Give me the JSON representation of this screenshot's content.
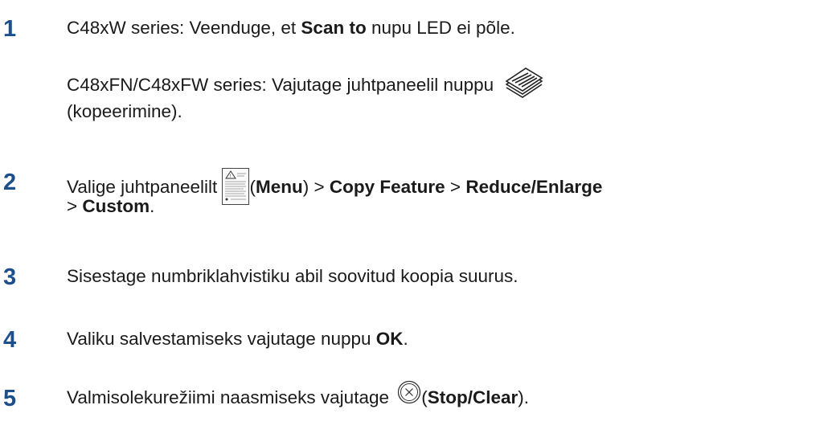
{
  "steps": [
    {
      "number": "1",
      "lines": [
        {
          "pre": "C48xW series: Veenduge, et ",
          "bold": "Scan to",
          "post": " nupu LED ei põle."
        },
        {
          "pre": "C48xFN/C48xFW series: Vajutage juhtpaneelil nuppu"
        },
        {
          "pre": "(kopeerimine)."
        }
      ],
      "icon": "copy-icon"
    },
    {
      "number": "2",
      "line1": {
        "pre": "Valige juhtpaneelilt ",
        "paren_open": "(",
        "menu": "Menu",
        "paren_close": ")",
        "sep1": " > ",
        "copy_feature": "Copy Feature",
        "sep2": " > ",
        "reduce": "Reduce/Enlarge"
      },
      "line2": {
        "sep": "> ",
        "custom": "Custom",
        "end": "."
      },
      "icon": "menu-icon"
    },
    {
      "number": "3",
      "text": "Sisestage numbriklahvistiku abil soovitud koopia suurus."
    },
    {
      "number": "4",
      "pre": "Valiku salvestamiseks vajutage nuppu ",
      "bold": "OK",
      "post": "."
    },
    {
      "number": "5",
      "pre": "Valmisolekurežiimi naasmiseks vajutage ",
      "paren_open": "(",
      "bold": "Stop/Clear",
      "post": ").",
      "icon": "stop-clear-icon"
    }
  ],
  "colors": {
    "step_number": "#1d4f8c",
    "text": "#1a1a1a"
  }
}
